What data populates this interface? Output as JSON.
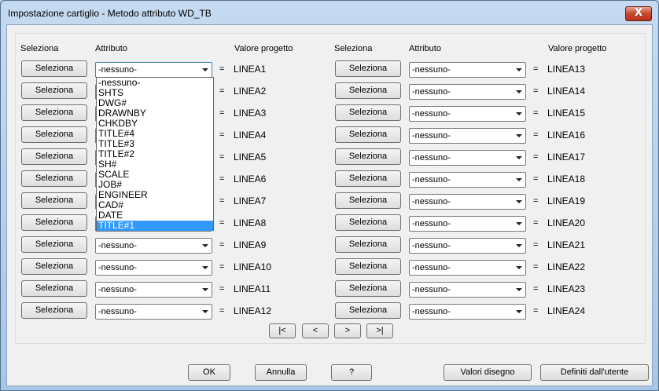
{
  "window": {
    "title": "Impostazione cartiglio - Metodo attributo WD_TB",
    "close_glyph": "X"
  },
  "headers": {
    "left": {
      "seleziona": "Seleziona",
      "attributo": "Attributo",
      "valore": "Valore progetto"
    },
    "right": {
      "seleziona": "Seleziona",
      "attributo": "Attributo",
      "valore": "Valore progetto"
    }
  },
  "rows_left": [
    {
      "button": "Seleziona",
      "attribute": "-nessuno-",
      "eq": "=",
      "value": "LINEA1"
    },
    {
      "button": "Seleziona",
      "attribute": "",
      "eq": "=",
      "value": "LINEA2"
    },
    {
      "button": "Seleziona",
      "attribute": "",
      "eq": "=",
      "value": "LINEA3"
    },
    {
      "button": "Seleziona",
      "attribute": "",
      "eq": "=",
      "value": "LINEA4"
    },
    {
      "button": "Seleziona",
      "attribute": "",
      "eq": "=",
      "value": "LINEA5"
    },
    {
      "button": "Seleziona",
      "attribute": "",
      "eq": "=",
      "value": "LINEA6"
    },
    {
      "button": "Seleziona",
      "attribute": "",
      "eq": "=",
      "value": "LINEA7"
    },
    {
      "button": "Seleziona",
      "attribute": "",
      "eq": "=",
      "value": "LINEA8"
    },
    {
      "button": "Seleziona",
      "attribute": "-nessuno-",
      "eq": "=",
      "value": "LINEA9"
    },
    {
      "button": "Seleziona",
      "attribute": "-nessuno-",
      "eq": "=",
      "value": "LINEA10"
    },
    {
      "button": "Seleziona",
      "attribute": "-nessuno-",
      "eq": "=",
      "value": "LINEA11"
    },
    {
      "button": "Seleziona",
      "attribute": "-nessuno-",
      "eq": "=",
      "value": "LINEA12"
    }
  ],
  "rows_right": [
    {
      "button": "Seleziona",
      "attribute": "-nessuno-",
      "eq": "=",
      "value": "LINEA13"
    },
    {
      "button": "Seleziona",
      "attribute": "-nessuno-",
      "eq": "=",
      "value": "LINEA14"
    },
    {
      "button": "Seleziona",
      "attribute": "-nessuno-",
      "eq": "=",
      "value": "LINEA15"
    },
    {
      "button": "Seleziona",
      "attribute": "-nessuno-",
      "eq": "=",
      "value": "LINEA16"
    },
    {
      "button": "Seleziona",
      "attribute": "-nessuno-",
      "eq": "=",
      "value": "LINEA17"
    },
    {
      "button": "Seleziona",
      "attribute": "-nessuno-",
      "eq": "=",
      "value": "LINEA18"
    },
    {
      "button": "Seleziona",
      "attribute": "-nessuno-",
      "eq": "=",
      "value": "LINEA19"
    },
    {
      "button": "Seleziona",
      "attribute": "-nessuno-",
      "eq": "=",
      "value": "LINEA20"
    },
    {
      "button": "Seleziona",
      "attribute": "-nessuno-",
      "eq": "=",
      "value": "LINEA21"
    },
    {
      "button": "Seleziona",
      "attribute": "-nessuno-",
      "eq": "=",
      "value": "LINEA22"
    },
    {
      "button": "Seleziona",
      "attribute": "-nessuno-",
      "eq": "=",
      "value": "LINEA23"
    },
    {
      "button": "Seleziona",
      "attribute": "-nessuno-",
      "eq": "=",
      "value": "LINEA24"
    }
  ],
  "dropdown": {
    "options": [
      "-nessuno-",
      "SHTS",
      "DWG#",
      "DRAWNBY",
      "CHKDBY",
      "TITLE#4",
      "TITLE#3",
      "TITLE#2",
      "SH#",
      "SCALE",
      "JOB#",
      "ENGINEER",
      "CAD#",
      "DATE",
      "TITLE#1"
    ],
    "highlighted": "TITLE#1"
  },
  "nav": {
    "first": "|<",
    "prev": "<",
    "next": ">",
    "last": ">|"
  },
  "footer": {
    "ok": "OK",
    "cancel": "Annulla",
    "help": "?",
    "drawing_values": "Valori disegno",
    "user_defined": "Definiti dall'utente"
  },
  "colors": {
    "highlight": "#3399ff",
    "close": "#c7462f",
    "frame": "#b9d1ea"
  }
}
